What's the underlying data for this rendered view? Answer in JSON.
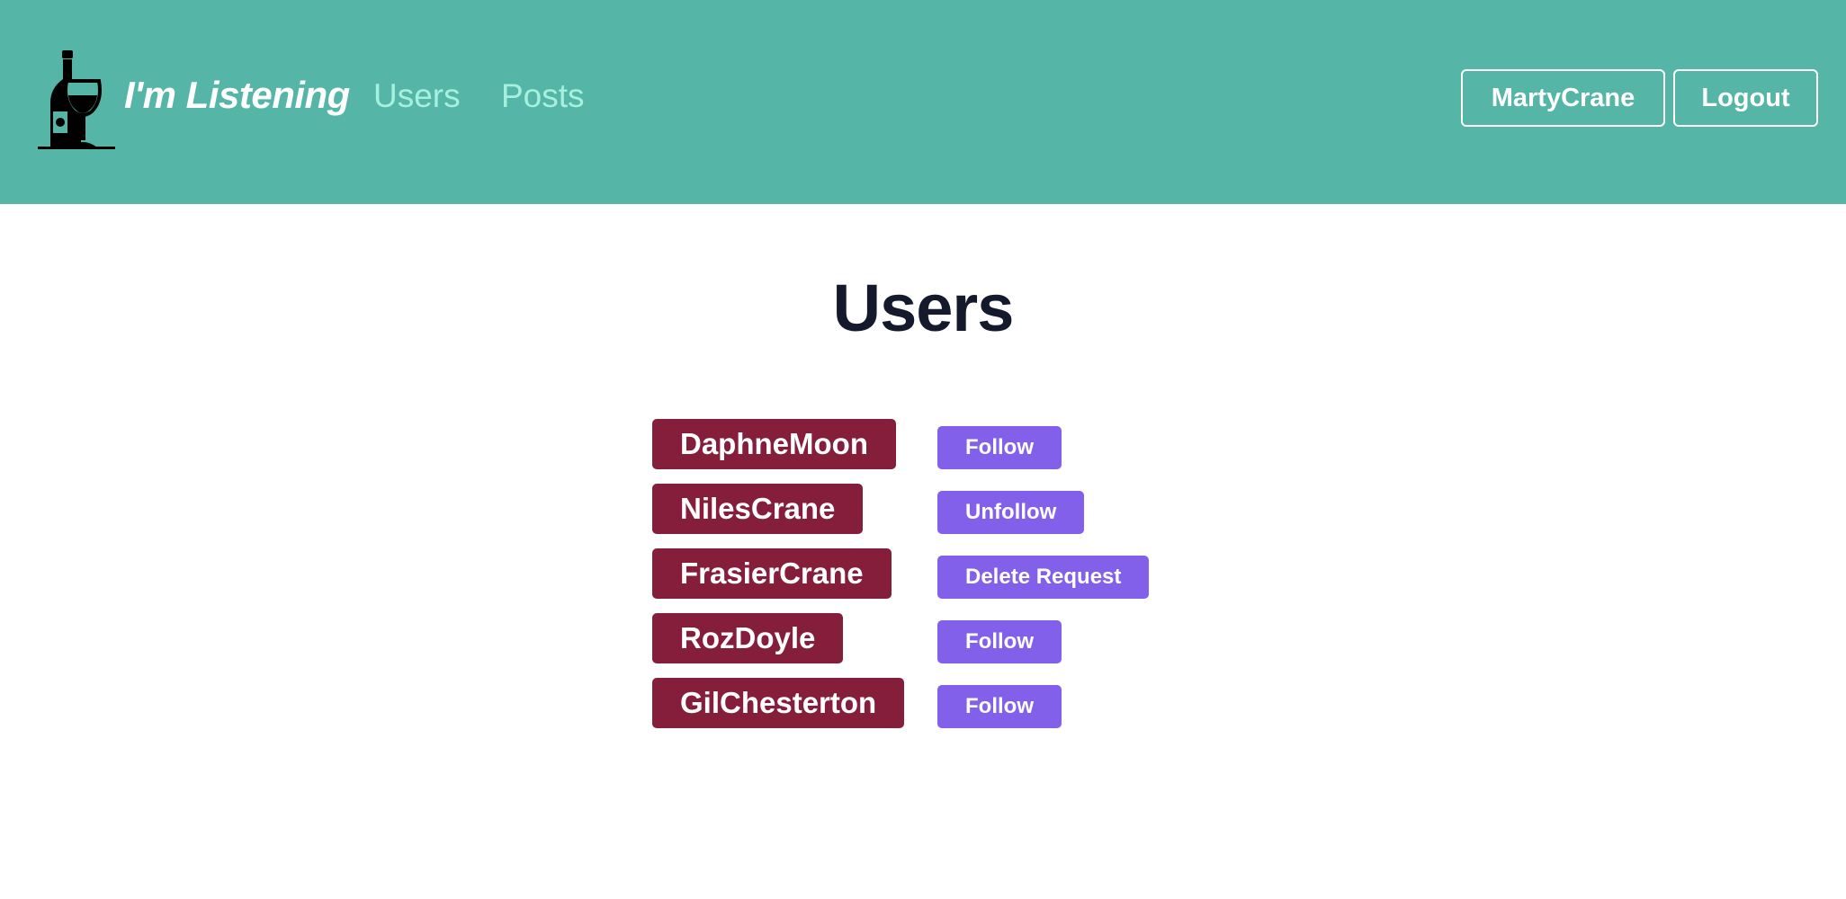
{
  "navbar": {
    "brand": "I'm Listening",
    "links": [
      {
        "label": "Users"
      },
      {
        "label": "Posts"
      }
    ],
    "current_user": "MartyCrane",
    "logout_label": "Logout",
    "background_color": "#55b5a6"
  },
  "main": {
    "title": "Users",
    "users": [
      {
        "username": "DaphneMoon",
        "action": "Follow"
      },
      {
        "username": "NilesCrane",
        "action": "Unfollow"
      },
      {
        "username": "FrasierCrane",
        "action": "Delete Request"
      },
      {
        "username": "RozDoyle",
        "action": "Follow"
      },
      {
        "username": "GilChesterton",
        "action": "Follow"
      }
    ]
  },
  "colors": {
    "username_badge": "#841e3b",
    "action_button": "#8360ea",
    "nav_link": "#a6f0de"
  },
  "icons": {
    "logo": "wine-bottle-glass-icon"
  }
}
